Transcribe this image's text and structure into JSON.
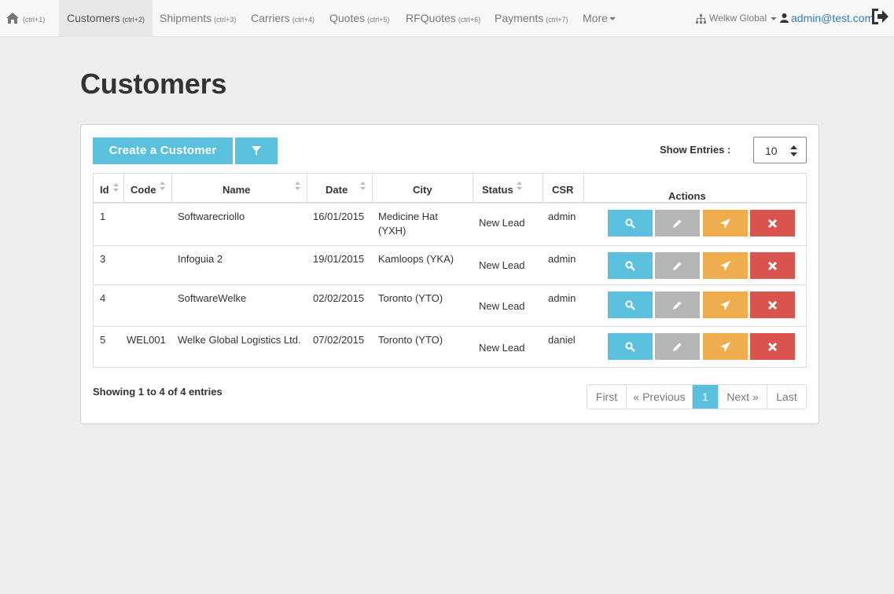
{
  "nav": {
    "home": {
      "shortcut": "(ctrl+1)"
    },
    "items": [
      {
        "label": "Customers",
        "shortcut": "(ctrl+2)"
      },
      {
        "label": "Shipments",
        "shortcut": "(ctrl+3)"
      },
      {
        "label": "Carriers",
        "shortcut": "(ctrl+4)"
      },
      {
        "label": "Quotes",
        "shortcut": "(ctrl+5)"
      },
      {
        "label": "RFQuotes",
        "shortcut": "(ctrl+6)"
      },
      {
        "label": "Payments",
        "shortcut": "(ctrl+7)"
      }
    ],
    "more": "More",
    "org": "Welkw Global",
    "user": "admin@test.com"
  },
  "page": {
    "title": "Customers"
  },
  "toolbar": {
    "create_label": "Create a Customer",
    "show_entries_label": "Show Entries :",
    "entries_value": "10"
  },
  "table": {
    "headers": [
      "Id",
      "Code",
      "Name",
      "Date",
      "City",
      "Status",
      "CSR",
      "Actions"
    ],
    "rows": [
      {
        "id": "1",
        "code": "",
        "name": "Softwarecriollo",
        "date": "16/01/2015",
        "city": "Medicine Hat (YXH)",
        "status": "New Lead",
        "csr": "admin"
      },
      {
        "id": "3",
        "code": "",
        "name": "Infoguia 2",
        "date": "19/01/2015",
        "city": "Kamloops (YKA)",
        "status": "New Lead",
        "csr": "admin"
      },
      {
        "id": "4",
        "code": "",
        "name": "SoftwareWelke",
        "date": "02/02/2015",
        "city": "Toronto (YTO)",
        "status": "New Lead",
        "csr": "admin"
      },
      {
        "id": "5",
        "code": "WEL001",
        "name": "Welke Global Logistics Ltd.",
        "date": "07/02/2015",
        "city": "Toronto (YTO)",
        "status": "New Lead",
        "csr": "daniel"
      }
    ]
  },
  "footer": {
    "showing": "Showing 1 to 4 of 4 entries"
  },
  "pagination": {
    "first": "First",
    "previous": "« Previous",
    "current": "1",
    "next": "Next »",
    "last": "Last"
  },
  "colors": {
    "info": "#5bc0de",
    "default": "#b5b5b5",
    "warning": "#f0ad4e",
    "danger": "#d9534f",
    "link": "#337ab7"
  },
  "icons": [
    "home-icon",
    "sitemap-icon",
    "user-icon",
    "sign-out-icon",
    "filter-icon",
    "search-icon",
    "pencil-icon",
    "send-icon",
    "close-icon",
    "sort-icon",
    "spinner-icon"
  ]
}
